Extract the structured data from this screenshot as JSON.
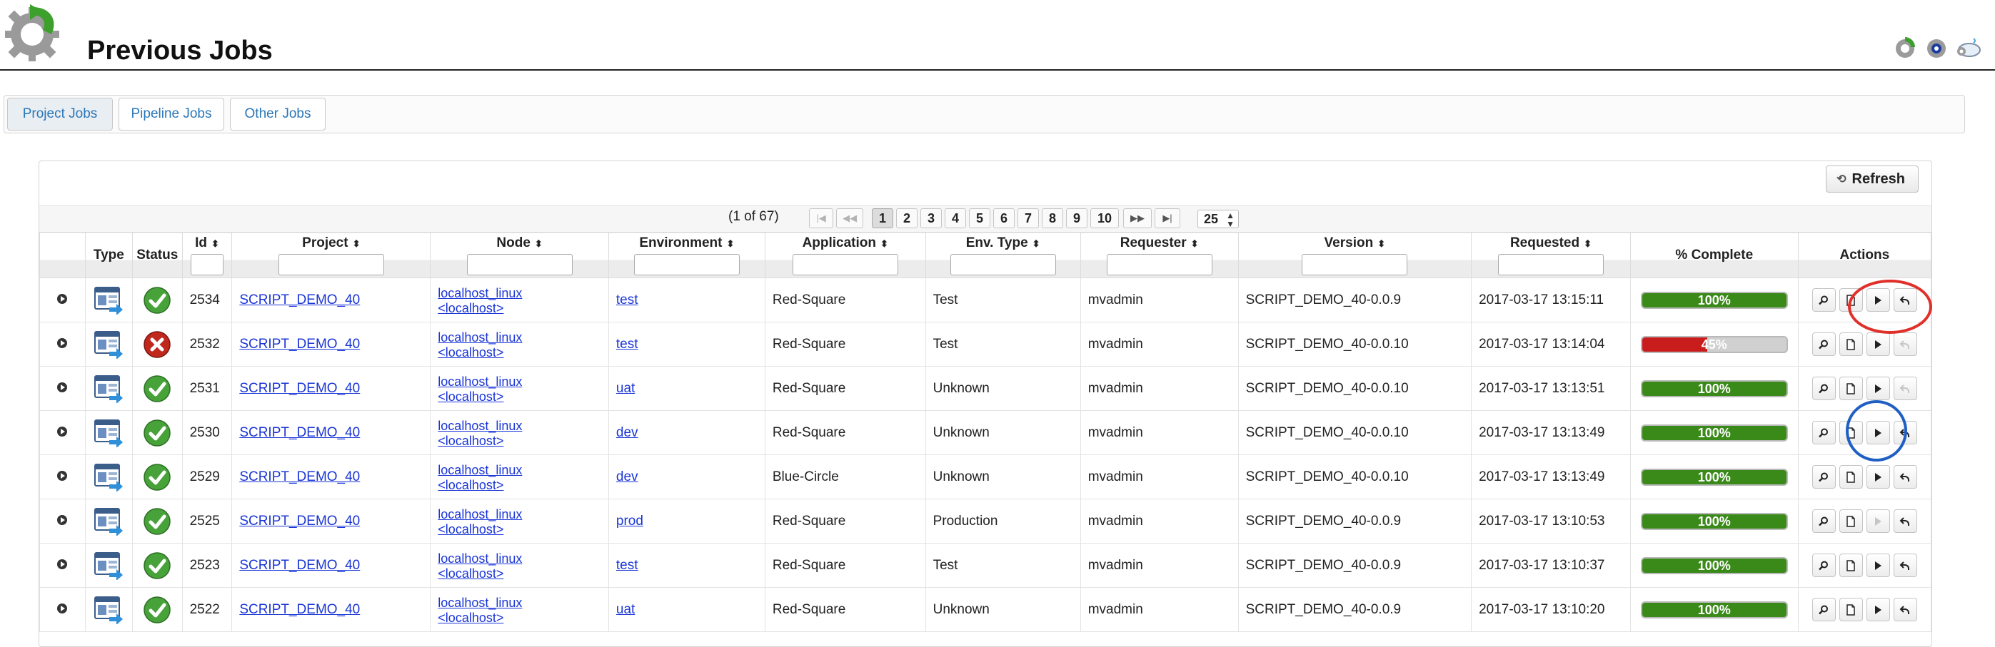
{
  "header": {
    "title": "Previous Jobs",
    "logo_icon": "gear-refresh-icon",
    "right_icons": [
      "green-gear-icon",
      "blue-gear-icon",
      "cloud-icon"
    ]
  },
  "tabs": [
    {
      "label": "Project Jobs",
      "active": true
    },
    {
      "label": "Pipeline Jobs",
      "active": false
    },
    {
      "label": "Other Jobs",
      "active": false
    }
  ],
  "toolbar": {
    "refresh_label": "Refresh"
  },
  "paginator": {
    "current_report": "(1 of 67)",
    "pages": [
      "1",
      "2",
      "3",
      "4",
      "5",
      "6",
      "7",
      "8",
      "9",
      "10"
    ],
    "active_page": "1",
    "rows_per_page": "25"
  },
  "columns": {
    "type": "Type",
    "status": "Status",
    "id": "Id",
    "project": "Project",
    "node": "Node",
    "environment": "Environment",
    "application": "Application",
    "env_type": "Env. Type",
    "requester": "Requester",
    "version": "Version",
    "requested": "Requested",
    "complete": "% Complete",
    "actions": "Actions"
  },
  "rows": [
    {
      "id": "2534",
      "project": "SCRIPT_DEMO_40",
      "node_line1": "localhost_linux",
      "node_line2": "<localhost>",
      "environment": "test",
      "application": "Red-Square",
      "env_type": "Test",
      "requester": "mvadmin",
      "version": "SCRIPT_DEMO_40-0.0.9",
      "requested": "2017-03-17 13:15:11",
      "complete_label": "100%",
      "complete": 100,
      "status": "success",
      "run_enabled": true,
      "rollback_enabled": true
    },
    {
      "id": "2532",
      "project": "SCRIPT_DEMO_40",
      "node_line1": "localhost_linux",
      "node_line2": "<localhost>",
      "environment": "test",
      "application": "Red-Square",
      "env_type": "Test",
      "requester": "mvadmin",
      "version": "SCRIPT_DEMO_40-0.0.10",
      "requested": "2017-03-17 13:14:04",
      "complete_label": "45%",
      "complete": 45,
      "status": "failed",
      "run_enabled": true,
      "rollback_enabled": false
    },
    {
      "id": "2531",
      "project": "SCRIPT_DEMO_40",
      "node_line1": "localhost_linux",
      "node_line2": "<localhost>",
      "environment": "uat",
      "application": "Red-Square",
      "env_type": "Unknown",
      "requester": "mvadmin",
      "version": "SCRIPT_DEMO_40-0.0.10",
      "requested": "2017-03-17 13:13:51",
      "complete_label": "100%",
      "complete": 100,
      "status": "success",
      "run_enabled": true,
      "rollback_enabled": false
    },
    {
      "id": "2530",
      "project": "SCRIPT_DEMO_40",
      "node_line1": "localhost_linux",
      "node_line2": "<localhost>",
      "environment": "dev",
      "application": "Red-Square",
      "env_type": "Unknown",
      "requester": "mvadmin",
      "version": "SCRIPT_DEMO_40-0.0.10",
      "requested": "2017-03-17 13:13:49",
      "complete_label": "100%",
      "complete": 100,
      "status": "success",
      "run_enabled": true,
      "rollback_enabled": true
    },
    {
      "id": "2529",
      "project": "SCRIPT_DEMO_40",
      "node_line1": "localhost_linux",
      "node_line2": "<localhost>",
      "environment": "dev",
      "application": "Blue-Circle",
      "env_type": "Unknown",
      "requester": "mvadmin",
      "version": "SCRIPT_DEMO_40-0.0.10",
      "requested": "2017-03-17 13:13:49",
      "complete_label": "100%",
      "complete": 100,
      "status": "success",
      "run_enabled": true,
      "rollback_enabled": true
    },
    {
      "id": "2525",
      "project": "SCRIPT_DEMO_40",
      "node_line1": "localhost_linux",
      "node_line2": "<localhost>",
      "environment": "prod",
      "application": "Red-Square",
      "env_type": "Production",
      "requester": "mvadmin",
      "version": "SCRIPT_DEMO_40-0.0.9",
      "requested": "2017-03-17 13:10:53",
      "complete_label": "100%",
      "complete": 100,
      "status": "success",
      "run_enabled": false,
      "rollback_enabled": true
    },
    {
      "id": "2523",
      "project": "SCRIPT_DEMO_40",
      "node_line1": "localhost_linux",
      "node_line2": "<localhost>",
      "environment": "test",
      "application": "Red-Square",
      "env_type": "Test",
      "requester": "mvadmin",
      "version": "SCRIPT_DEMO_40-0.0.9",
      "requested": "2017-03-17 13:10:37",
      "complete_label": "100%",
      "complete": 100,
      "status": "success",
      "run_enabled": true,
      "rollback_enabled": true
    },
    {
      "id": "2522",
      "project": "SCRIPT_DEMO_40",
      "node_line1": "localhost_linux",
      "node_line2": "<localhost>",
      "environment": "uat",
      "application": "Red-Square",
      "env_type": "Unknown",
      "requester": "mvadmin",
      "version": "SCRIPT_DEMO_40-0.0.9",
      "requested": "2017-03-17 13:10:20",
      "complete_label": "100%",
      "complete": 100,
      "status": "success",
      "run_enabled": true,
      "rollback_enabled": true
    }
  ],
  "annotation_colors": {
    "red_circle": "#e0302a",
    "blue_circle": "#1f5fc4"
  }
}
